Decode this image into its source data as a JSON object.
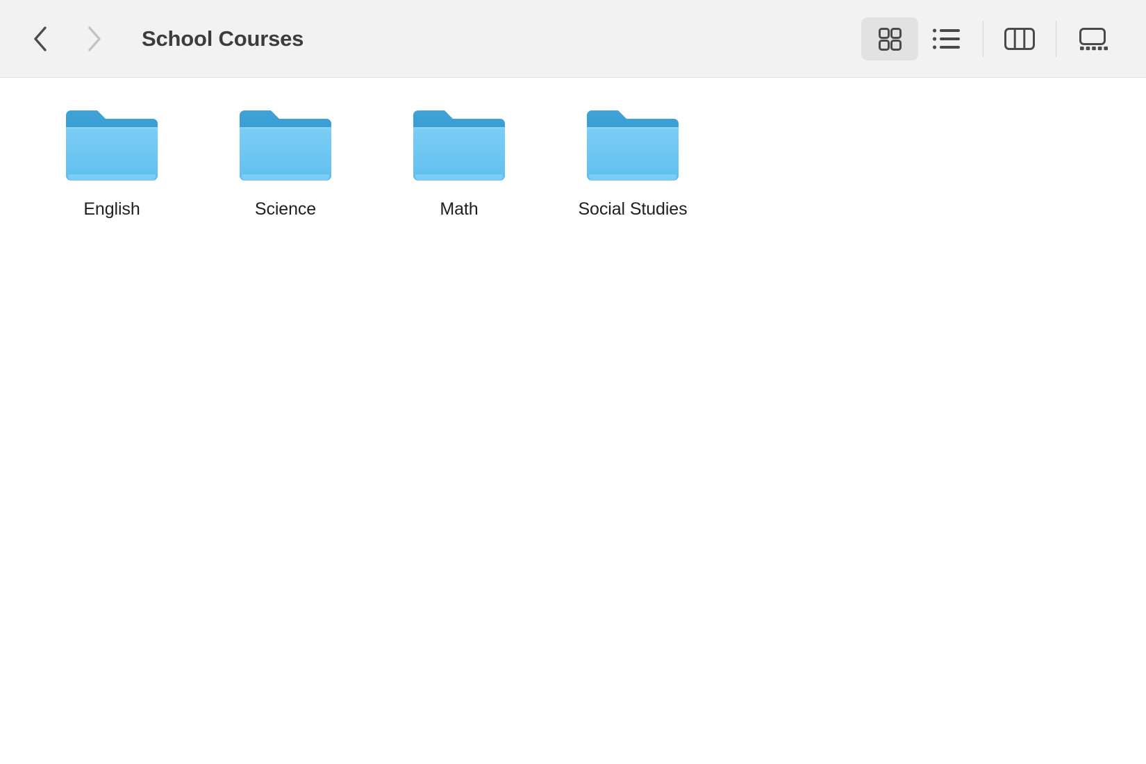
{
  "window": {
    "title": "School Courses",
    "background_color": "#ffffff",
    "toolbar_color": "#f2f2f2"
  },
  "toolbar": {
    "back_label": "Back",
    "forward_label": "Forward",
    "back_icon": "chevron-left-icon",
    "forward_icon": "chevron-right-icon",
    "back_enabled": true,
    "forward_enabled": false,
    "title": "School Courses",
    "view_options": [
      {
        "id": "icon-view",
        "label": "Icon View",
        "icon": "grid-icon",
        "selected": true
      },
      {
        "id": "list-view",
        "label": "List View",
        "icon": "list-icon",
        "selected": false
      },
      {
        "id": "column-view",
        "label": "Column View",
        "icon": "columns-icon",
        "selected": false
      },
      {
        "id": "gallery-view",
        "label": "Gallery View",
        "icon": "gallery-icon",
        "selected": false
      }
    ]
  },
  "content": {
    "view_mode": "icon-view",
    "items": [
      {
        "name": "English",
        "type": "folder",
        "icon": "folder-icon"
      },
      {
        "name": "Science",
        "type": "folder",
        "icon": "folder-icon"
      },
      {
        "name": "Math",
        "type": "folder",
        "icon": "folder-icon"
      },
      {
        "name": "Social Studies",
        "type": "folder",
        "icon": "folder-icon"
      }
    ]
  },
  "colors": {
    "folder_tab": "#2f93cd",
    "folder_body_top": "#77ccf4",
    "folder_body_bottom": "#5fc0ef",
    "title_text": "#3c3c3e",
    "label_text": "#1f1f21",
    "chevron_enabled": "#4d4d4f",
    "chevron_disabled": "#c3c3c3",
    "icon_stroke": "#4a4a4c",
    "selected_button_bg": "#e2e2e2"
  }
}
